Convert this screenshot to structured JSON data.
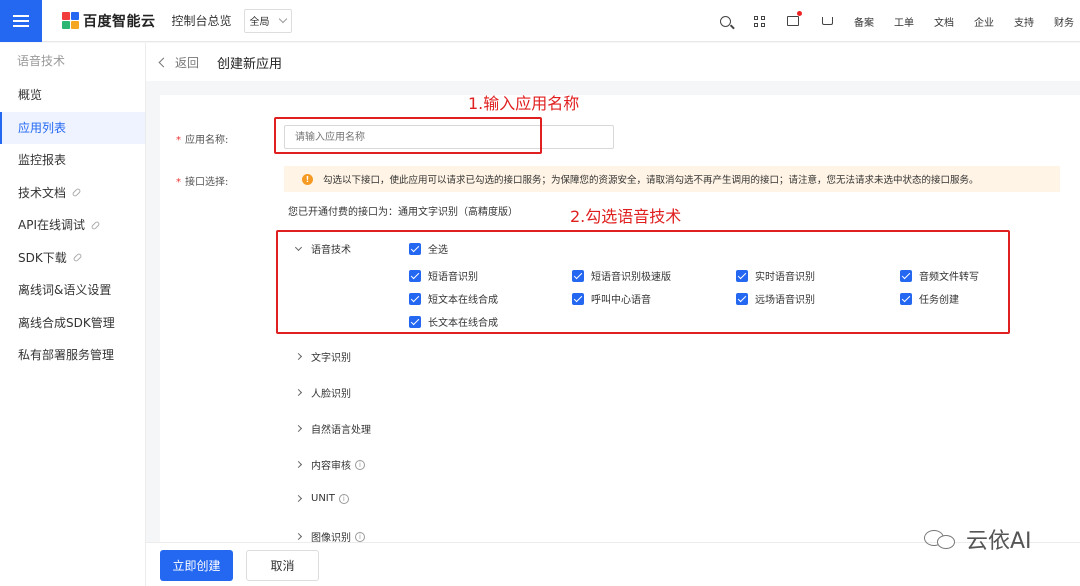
{
  "topbar": {
    "logo_text": "百度智能云",
    "console_label": "控制台总览",
    "region_value": "全局",
    "icons": [
      "search-icon",
      "grid-icon",
      "message-icon",
      "cart-icon"
    ],
    "links": [
      "备案",
      "工单",
      "文档",
      "企业",
      "支持",
      "财务"
    ],
    "colors": {
      "accent": "#2468f2",
      "alert": "#e02020"
    }
  },
  "sidebar": {
    "title": "语音技术",
    "items": [
      {
        "label": "概览",
        "active": false,
        "external": false
      },
      {
        "label": "应用列表",
        "active": true,
        "external": false
      },
      {
        "label": "监控报表",
        "active": false,
        "external": false
      },
      {
        "label": "技术文档",
        "active": false,
        "external": true
      },
      {
        "label": "API在线调试",
        "active": false,
        "external": true
      },
      {
        "label": "SDK下载",
        "active": false,
        "external": true
      },
      {
        "label": "离线词&语义设置",
        "active": false,
        "external": false
      },
      {
        "label": "离线合成SDK管理",
        "active": false,
        "external": false
      },
      {
        "label": "私有部署服务管理",
        "active": false,
        "external": false
      }
    ]
  },
  "header": {
    "back_label": "返回",
    "title": "创建新应用"
  },
  "form": {
    "name_label": "应用名称:",
    "name_placeholder": "请输入应用名称",
    "api_label": "接口选择:",
    "notice": "勾选以下接口，使此应用可以请求已勾选的接口服务；为保障您的资源安全，请取消勾选不再产生调用的接口；请注意，您无法请求未选中状态的接口服务。",
    "paid_text": "您已开通付费的接口为：通用文字识别（高精度版）",
    "speech": {
      "title": "语音技术",
      "select_all": "全选",
      "options": [
        "短语音识别",
        "短语音识别极速版",
        "实时语音识别",
        "音频文件转写",
        "短文本在线合成",
        "呼叫中心语音",
        "远场语音识别",
        "任务创建",
        "长文本在线合成"
      ]
    },
    "categories": [
      "文字识别",
      "人脸识别",
      "自然语言处理",
      "内容审核",
      "UNIT",
      "图像识别"
    ]
  },
  "annotations": {
    "step1": "1.输入应用名称",
    "step2": "2.勾选语音技术"
  },
  "footer": {
    "create_label": "立即创建",
    "cancel_label": "取消"
  },
  "watermark": {
    "text": "云依AI"
  }
}
